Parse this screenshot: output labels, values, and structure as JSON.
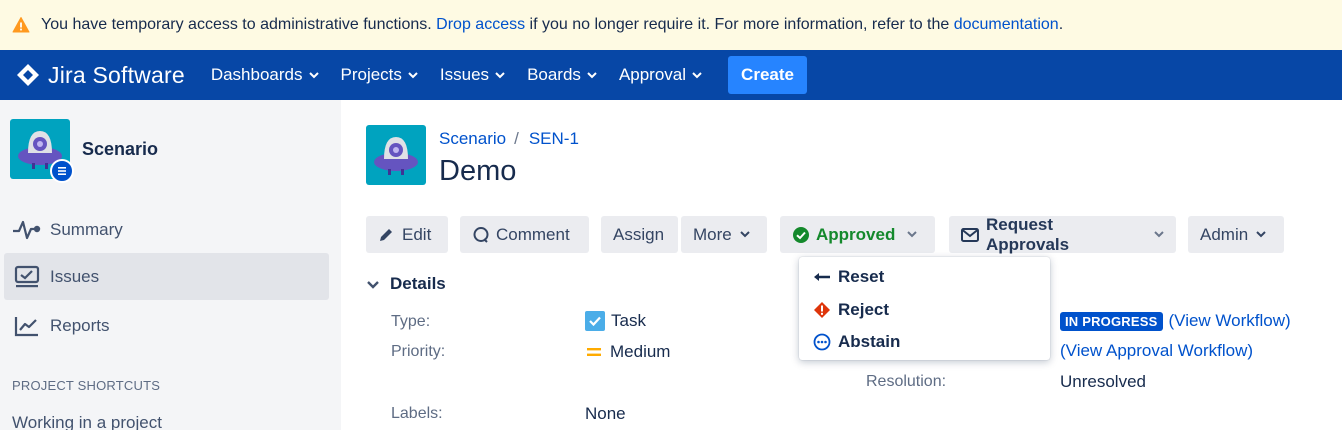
{
  "banner": {
    "text_before": "You have temporary access to administrative functions. ",
    "drop_access": "Drop access",
    "text_middle": " if you no longer require it. For more information, refer to the ",
    "documentation": "documentation",
    "text_after": "."
  },
  "nav": {
    "logo": "Jira Software",
    "items": [
      {
        "label": "Dashboards"
      },
      {
        "label": "Projects"
      },
      {
        "label": "Issues"
      },
      {
        "label": "Boards"
      },
      {
        "label": "Approval"
      }
    ],
    "create": "Create"
  },
  "sidebar": {
    "project_name": "Scenario",
    "items": [
      {
        "label": "Summary",
        "icon": "activity-icon"
      },
      {
        "label": "Issues",
        "icon": "issues-icon"
      },
      {
        "label": "Reports",
        "icon": "reports-icon"
      }
    ],
    "shortcuts_heading": "PROJECT SHORTCUTS",
    "shortcut_link": "Working in a project"
  },
  "issue": {
    "breadcrumb_project": "Scenario",
    "breadcrumb_sep": "/",
    "breadcrumb_key": "SEN-1",
    "title": "Demo"
  },
  "toolbar": {
    "edit": "Edit",
    "comment": "Comment",
    "assign": "Assign",
    "more": "More",
    "approved": "Approved",
    "request_approvals": "Request Approvals",
    "admin": "Admin"
  },
  "approval_menu": {
    "items": [
      {
        "label": "Reset",
        "icon": "arrow-left-icon"
      },
      {
        "label": "Reject",
        "icon": "error-icon"
      },
      {
        "label": "Abstain",
        "icon": "more-circle-icon"
      }
    ]
  },
  "details": {
    "heading": "Details",
    "type_label": "Type:",
    "type_value": "Task",
    "priority_label": "Priority:",
    "priority_value": "Medium",
    "status_value": "IN PROGRESS",
    "view_workflow": "(View Workflow)",
    "view_approval_workflow": "(View Approval Workflow)",
    "resolution_label": "Resolution:",
    "resolution_value": "Unresolved",
    "labels_label": "Labels:",
    "labels_value": "None"
  },
  "colors": {
    "nav_bg": "#0747a6",
    "create_bg": "#2684ff",
    "banner_bg": "#fefae3",
    "link": "#0052cc",
    "approved": "#14892c",
    "reject": "#de350b"
  }
}
